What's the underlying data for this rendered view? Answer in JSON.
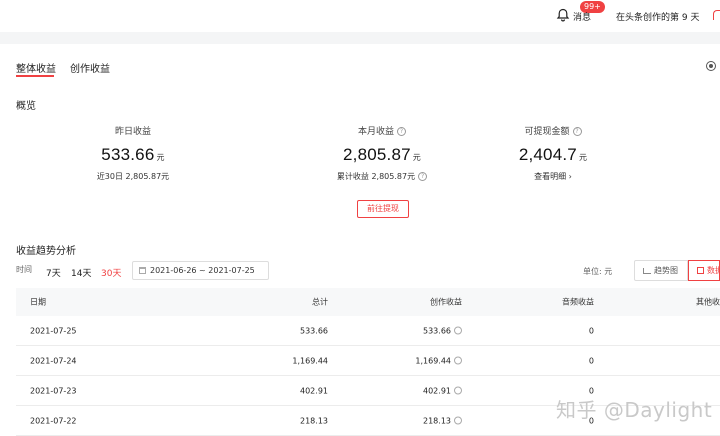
{
  "topbar": {
    "messages_label": "消息",
    "messages_badge": "99+",
    "creation_days": "在头条创作的第 9 天"
  },
  "tabs": [
    {
      "label": "整体收益",
      "active": true
    },
    {
      "label": "创作收益",
      "active": false
    }
  ],
  "overview": {
    "title": "概览",
    "yesterday": {
      "label": "昨日收益",
      "value": "533.66",
      "unit": "元",
      "sub": "近30日 2,805.87元"
    },
    "month": {
      "label": "本月收益",
      "value": "2,805.87",
      "unit": "元",
      "sub": "累计收益 2,805.87元"
    },
    "withdrawable": {
      "label": "可提现金额",
      "value": "2,404.7",
      "unit": "元",
      "sub": "查看明细 ›"
    },
    "withdraw_button": "前往提现"
  },
  "trend": {
    "title": "收益趋势分析",
    "time_label": "时间",
    "periods": [
      "7天",
      "14天",
      "30天"
    ],
    "selected_period": "30天",
    "date_range": "2021-06-26 ~ 2021-07-25",
    "unit_label": "单位:  元",
    "view_chart_label": "趋势图",
    "view_table_label": "数据"
  },
  "table": {
    "columns": [
      "日期",
      "总计",
      "创作收益",
      "音频收益",
      "其他收"
    ],
    "rows": [
      {
        "date": "2021-07-25",
        "total": "533.66",
        "creation": "533.66",
        "audio": "0"
      },
      {
        "date": "2021-07-24",
        "total": "1,169.44",
        "creation": "1,169.44",
        "audio": "0"
      },
      {
        "date": "2021-07-23",
        "total": "402.91",
        "creation": "402.91",
        "audio": "0"
      },
      {
        "date": "2021-07-22",
        "total": "218.13",
        "creation": "218.13",
        "audio": "0"
      }
    ]
  },
  "watermark": "知乎 @Daylight",
  "colors": {
    "accent": "#f04142",
    "background": "#f4f5f6"
  }
}
